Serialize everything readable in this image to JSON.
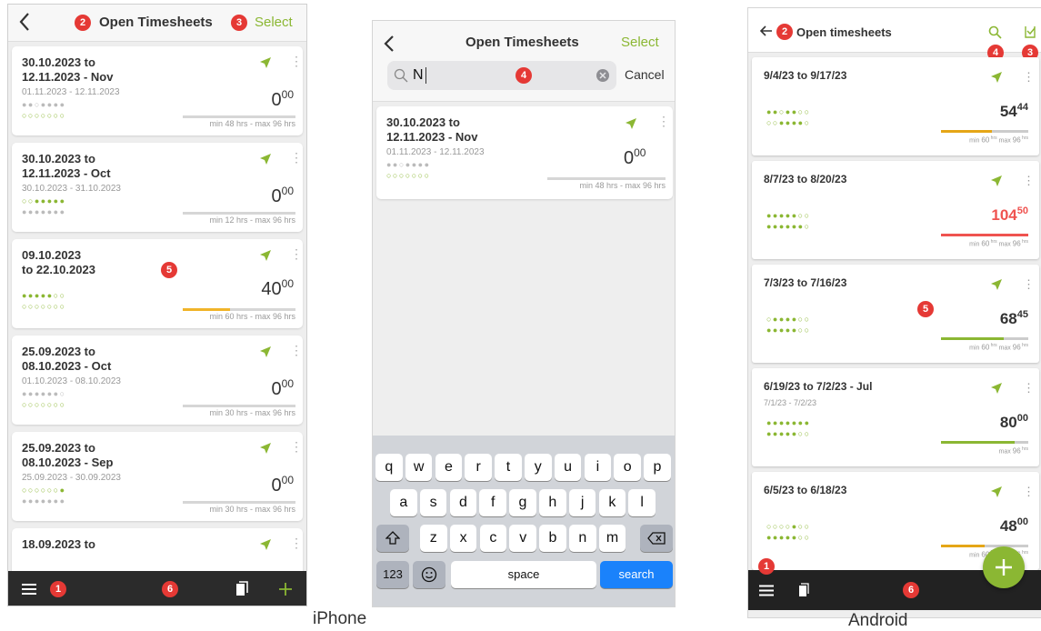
{
  "badges": {
    "b1": "1",
    "b2": "2",
    "b3": "3",
    "b4": "4",
    "b5": "5",
    "b6": "6"
  },
  "captions": {
    "iphone": "iPhone",
    "android": "Android"
  },
  "iphone1": {
    "title": "Open Timesheets",
    "select": "Select",
    "cards": [
      {
        "l1": "30.10.2023 to",
        "l2": "12.11.2023 - Nov",
        "sub": "01.11.2023 - 12.11.2023",
        "hours": "0",
        "mins": "00",
        "d1": "●●○●●●●",
        "d2": "○○○○○○○",
        "range": "min 48 hrs - max 96 hrs",
        "fill": 0
      },
      {
        "l1": "30.10.2023 to",
        "l2": "12.11.2023 - Oct",
        "sub": "30.10.2023 - 31.10.2023",
        "hours": "0",
        "mins": "00",
        "d1": "○○●●●●●",
        "d2": "●●●●●●●",
        "range": "min 12 hrs - max 96 hrs",
        "fill": 0
      },
      {
        "l1": "09.10.2023",
        "l2": "to 22.10.2023",
        "sub": "",
        "hours": "40",
        "mins": "00",
        "d1": "●●●●●○○",
        "d2": "○○○○○○○",
        "range": "min 60 hrs - max 96 hrs",
        "fill": 0.42
      },
      {
        "l1": "25.09.2023 to",
        "l2": "08.10.2023 - Oct",
        "sub": "01.10.2023 - 08.10.2023",
        "hours": "0",
        "mins": "00",
        "d1": "●●●●●●○",
        "d2": "○○○○○○○",
        "range": "min 30 hrs - max 96 hrs",
        "fill": 0
      },
      {
        "l1": "25.09.2023 to",
        "l2": "08.10.2023 - Sep",
        "sub": "25.09.2023 - 30.09.2023",
        "hours": "0",
        "mins": "00",
        "d1": "○○○○○○●",
        "d2": "●●●●●●●",
        "range": "min 30 hrs - max 96 hrs",
        "fill": 0
      },
      {
        "l1": "18.09.2023 to",
        "l2": "",
        "sub": "",
        "hours": "",
        "mins": "",
        "d1": "",
        "d2": "",
        "range": "",
        "fill": 0
      }
    ]
  },
  "iphone2": {
    "title": "Open Timesheets",
    "select": "Select",
    "search_value": "N",
    "cancel": "Cancel",
    "card": {
      "l1": "30.10.2023 to",
      "l2": "12.11.2023 - Nov",
      "sub": "01.11.2023 - 12.11.2023",
      "hours": "0",
      "mins": "00",
      "d1": "●●○●●●●",
      "d2": "○○○○○○○",
      "range": "min 48 hrs - max 96 hrs"
    },
    "keyboard": {
      "row1": [
        "q",
        "w",
        "e",
        "r",
        "t",
        "y",
        "u",
        "i",
        "o",
        "p"
      ],
      "row2": [
        "a",
        "s",
        "d",
        "f",
        "g",
        "h",
        "j",
        "k",
        "l"
      ],
      "row3": [
        "z",
        "x",
        "c",
        "v",
        "b",
        "n",
        "m"
      ],
      "num": "123",
      "space": "space",
      "search": "search"
    }
  },
  "android": {
    "title": "Open timesheets",
    "cards": [
      {
        "title": "9/4/23 to 9/17/23",
        "sub": "",
        "hours": "54",
        "mins": "44",
        "d1": "●●○●●○○",
        "d2": "○○●●●●○",
        "fill": 0.58,
        "fillColor": "#e5a617",
        "hoursColor": "#333333",
        "min": "60",
        "max": "96"
      },
      {
        "title": "8/7/23 to 8/20/23",
        "sub": "",
        "hours": "104",
        "mins": "50",
        "d1": "●●●●●○○",
        "d2": "●●●●●●○",
        "fill": 1.0,
        "fillColor": "#ef5350",
        "hoursColor": "#ef5350",
        "min": "60",
        "max": "96"
      },
      {
        "title": "7/3/23 to 7/16/23",
        "sub": "",
        "hours": "68",
        "mins": "45",
        "d1": "○●●●●○○",
        "d2": "●●●●●○○",
        "fill": 0.72,
        "fillColor": "#8bb733",
        "hoursColor": "#333333",
        "min": "60",
        "max": "96"
      },
      {
        "title": "6/19/23 to 7/2/23 - Jul",
        "sub": "7/1/23 - 7/2/23",
        "hours": "80",
        "mins": "00",
        "d1": "●●●●●●●",
        "d2": "●●●●●○○",
        "fill": 0.84,
        "fillColor": "#8bb733",
        "hoursColor": "#333333",
        "min": "",
        "max": "96"
      },
      {
        "title": "6/5/23 to 6/18/23",
        "sub": "",
        "hours": "48",
        "mins": "00",
        "d1": "○○○○●○○",
        "d2": "●●●●●○○",
        "fill": 0.5,
        "fillColor": "#e5a617",
        "hoursColor": "#333333",
        "min": "60",
        "max": "96"
      }
    ]
  },
  "colors": {
    "accent": "#8bb733",
    "badge": "#e53935",
    "warning": "#e5a617",
    "danger": "#ef5350",
    "keyboard": "#d1d4d9",
    "search_key": "#1a82fb"
  },
  "icons": [
    "back-icon",
    "search-icon",
    "select-check-icon",
    "send-icon",
    "kebab-icon",
    "menu-icon",
    "copy-icon",
    "plus-icon",
    "clear-icon",
    "shift-icon",
    "backspace-icon",
    "emoji-icon"
  ]
}
